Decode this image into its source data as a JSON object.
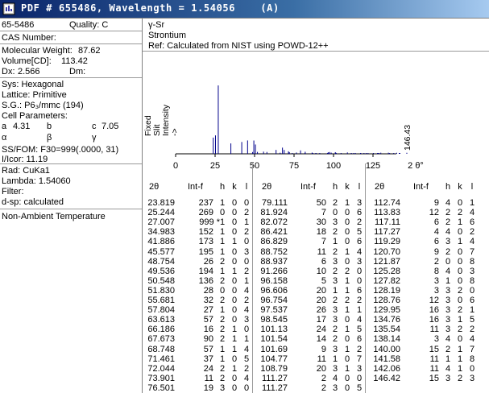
{
  "window": {
    "title": "PDF # 655486, Wavelength = 1.54056    (A)",
    "accent_color": "#0a246a"
  },
  "card": {
    "pdf_number": "65-5486",
    "quality": "Quality: C",
    "cas_number": "CAS Number:",
    "mol_weight_label": "Molecular Weight:",
    "mol_weight": "87.62",
    "volume_label": "Volume[CD]:",
    "volume": "113.42",
    "dx_label": "Dx:",
    "dx": "2.566",
    "dm_label": "Dm:",
    "sys": "Sys: Hexagonal",
    "lattice": "Lattice: Primitive",
    "sg": "S.G.: P6₃/mmc (194)",
    "cell_params": "Cell Parameters:",
    "a_label": "a",
    "a": "4.31",
    "b_label": "b",
    "c_label": "c",
    "c": "7.05",
    "alpha": "α",
    "beta": "β",
    "gamma": "γ",
    "ssfom": "SS/FOM: F30=999(.0000, 31)",
    "icor": "I/Icor:  11.19",
    "rad": "Rad: CuKa1",
    "lambda": "Lambda: 1.54060",
    "filter": "Filter:",
    "dsp": "d-sp: calculated",
    "nonambient": "Non-Ambient Temperature"
  },
  "header": {
    "phase": "γ-Sr",
    "name": "Strontium",
    "ref": "Ref:  Calculated from NIST using POWD-12++"
  },
  "chart_data": {
    "type": "bar",
    "ylabel_lines": [
      "Fixed",
      "Slit",
      "Intensity",
      "->"
    ],
    "xlabel": "2 θ°",
    "xlim": [
      0,
      150
    ],
    "ylim": [
      0,
      1000
    ],
    "xticks": [
      "0",
      "25",
      "50",
      "75",
      "100",
      "125"
    ],
    "annotation": "146.43",
    "color": "#00008b",
    "x": [
      23.819,
      25.244,
      27.007,
      34.983,
      41.886,
      45.577,
      48.754,
      49.536,
      50.548,
      51.83,
      55.681,
      57.804,
      63.613,
      66.186,
      67.673,
      68.748,
      71.461,
      72.044,
      73.901,
      76.501,
      79.111,
      81.924,
      82.072,
      86.421,
      86.829,
      88.752,
      88.937,
      91.266,
      96.158,
      96.606,
      96.754,
      97.537,
      98.545,
      101.13,
      101.54,
      101.69,
      104.77,
      108.79,
      111.27,
      111.27,
      112.74,
      113.83,
      117.11,
      117.27,
      119.29,
      120.7,
      121.87,
      125.28,
      127.82,
      128.19,
      128.76,
      129.95,
      134.76,
      135.54,
      138.14,
      140.0,
      141.58,
      142.06,
      146.42
    ],
    "values": [
      237,
      269,
      999,
      152,
      173,
      195,
      26,
      194,
      136,
      28,
      32,
      27,
      57,
      16,
      90,
      57,
      37,
      24,
      11,
      19,
      50,
      7,
      30,
      18,
      7,
      11,
      6,
      10,
      5,
      20,
      20,
      26,
      17,
      24,
      14,
      9,
      11,
      20,
      2,
      2,
      9,
      12,
      6,
      4,
      6,
      9,
      2,
      8,
      3,
      3,
      12,
      16,
      16,
      11,
      3,
      15,
      11,
      11,
      15
    ]
  },
  "table": {
    "headers": [
      "2θ",
      "Int-f",
      "h",
      "k",
      "l"
    ],
    "columns": [
      [
        [
          "23.819",
          "237",
          "1",
          "0",
          "0"
        ],
        [
          "25.244",
          "269",
          "0",
          "0",
          "2"
        ],
        [
          "27.007",
          "999 *",
          "1",
          "0",
          "1"
        ],
        [
          "34.983",
          "152",
          "1",
          "0",
          "2"
        ],
        [
          "41.886",
          "173",
          "1",
          "1",
          "0"
        ],
        [
          "45.577",
          "195",
          "1",
          "0",
          "3"
        ],
        [
          "48.754",
          "26",
          "2",
          "0",
          "0"
        ],
        [
          "49.536",
          "194",
          "1",
          "1",
          "2"
        ],
        [
          "50.548",
          "136",
          "2",
          "0",
          "1"
        ],
        [
          "51.830",
          "28",
          "0",
          "0",
          "4"
        ],
        [
          "55.681",
          "32",
          "2",
          "0",
          "2"
        ],
        [
          "57.804",
          "27",
          "1",
          "0",
          "4"
        ],
        [
          "63.613",
          "57",
          "2",
          "0",
          "3"
        ],
        [
          "66.186",
          "16",
          "2",
          "1",
          "0"
        ],
        [
          "67.673",
          "90",
          "2",
          "1",
          "1"
        ],
        [
          "68.748",
          "57",
          "1",
          "1",
          "4"
        ],
        [
          "71.461",
          "37",
          "1",
          "0",
          "5"
        ],
        [
          "72.044",
          "24",
          "2",
          "1",
          "2"
        ],
        [
          "73.901",
          "11",
          "2",
          "0",
          "4"
        ],
        [
          "76.501",
          "19",
          "3",
          "0",
          "0"
        ]
      ],
      [
        [
          "79.111",
          "50",
          "2",
          "1",
          "3"
        ],
        [
          "81.924",
          "7",
          "0",
          "0",
          "6"
        ],
        [
          "82.072",
          "30",
          "3",
          "0",
          "2"
        ],
        [
          "86.421",
          "18",
          "2",
          "0",
          "5"
        ],
        [
          "86.829",
          "7",
          "1",
          "0",
          "6"
        ],
        [
          "88.752",
          "11",
          "2",
          "1",
          "4"
        ],
        [
          "88.937",
          "6",
          "3",
          "0",
          "3"
        ],
        [
          "91.266",
          "10",
          "2",
          "2",
          "0"
        ],
        [
          "96.158",
          "5",
          "3",
          "1",
          "0"
        ],
        [
          "96.606",
          "20",
          "1",
          "1",
          "6"
        ],
        [
          "96.754",
          "20",
          "2",
          "2",
          "2"
        ],
        [
          "97.537",
          "26",
          "3",
          "1",
          "1"
        ],
        [
          "98.545",
          "17",
          "3",
          "0",
          "4"
        ],
        [
          "101.13",
          "24",
          "2",
          "1",
          "5"
        ],
        [
          "101.54",
          "14",
          "2",
          "0",
          "6"
        ],
        [
          "101.69",
          "9",
          "3",
          "1",
          "2"
        ],
        [
          "104.77",
          "11",
          "1",
          "0",
          "7"
        ],
        [
          "108.79",
          "20",
          "3",
          "1",
          "3"
        ],
        [
          "111.27",
          "2",
          "4",
          "0",
          "0"
        ],
        [
          "111.27",
          "2",
          "3",
          "0",
          "5"
        ]
      ],
      [
        [
          "112.74",
          "9",
          "4",
          "0",
          "1"
        ],
        [
          "113.83",
          "12",
          "2",
          "2",
          "4"
        ],
        [
          "117.11",
          "6",
          "2",
          "1",
          "6"
        ],
        [
          "117.27",
          "4",
          "4",
          "0",
          "2"
        ],
        [
          "119.29",
          "6",
          "3",
          "1",
          "4"
        ],
        [
          "120.70",
          "9",
          "2",
          "0",
          "7"
        ],
        [
          "121.87",
          "2",
          "0",
          "0",
          "8"
        ],
        [
          "125.28",
          "8",
          "4",
          "0",
          "3"
        ],
        [
          "127.82",
          "3",
          "1",
          "0",
          "8"
        ],
        [
          "128.19",
          "3",
          "3",
          "2",
          "0"
        ],
        [
          "128.76",
          "12",
          "3",
          "0",
          "6"
        ],
        [
          "129.95",
          "16",
          "3",
          "2",
          "1"
        ],
        [
          "134.76",
          "16",
          "3",
          "1",
          "5"
        ],
        [
          "135.54",
          "11",
          "3",
          "2",
          "2"
        ],
        [
          "138.14",
          "3",
          "4",
          "0",
          "4"
        ],
        [
          "140.00",
          "15",
          "2",
          "1",
          "7"
        ],
        [
          "141.58",
          "11",
          "1",
          "1",
          "8"
        ],
        [
          "142.06",
          "11",
          "4",
          "1",
          "0"
        ],
        [
          "146.42",
          "15",
          "3",
          "2",
          "3"
        ]
      ]
    ]
  }
}
